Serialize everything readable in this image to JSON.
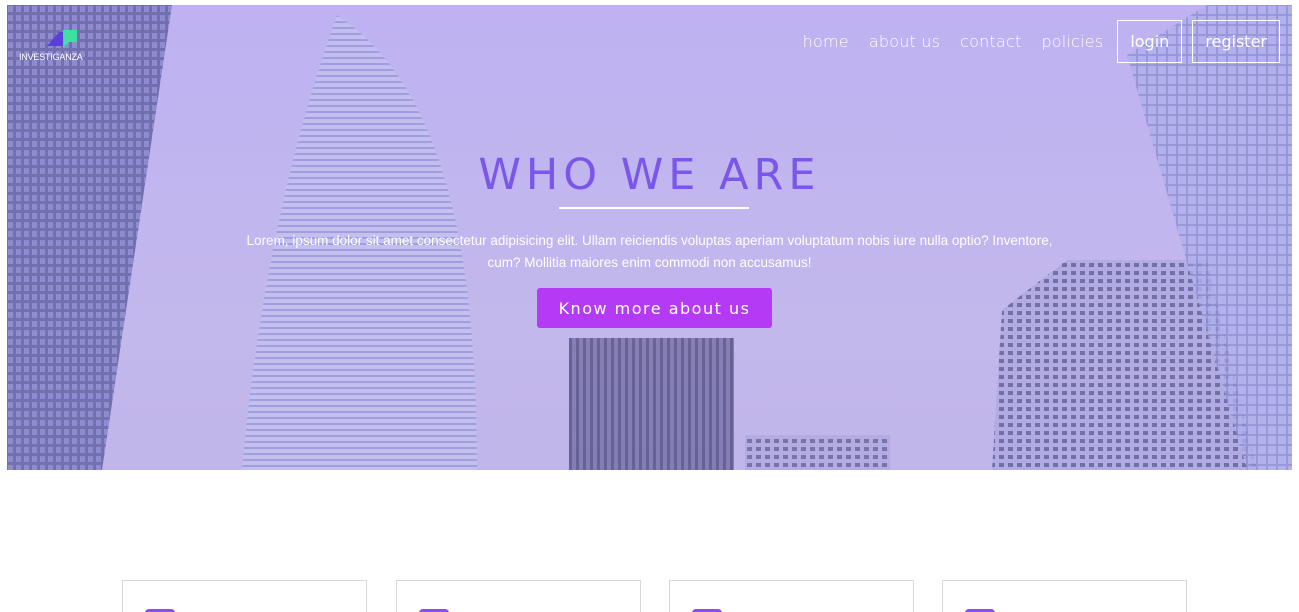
{
  "brand": {
    "name": "INVESTIGANZA",
    "colors": {
      "primary": "#7a56ea",
      "cta": "#b53af5",
      "logo_blue": "#5b3fd8",
      "logo_green": "#3fe0a0"
    }
  },
  "nav": {
    "links": [
      "home",
      "about us",
      "contact",
      "policies"
    ],
    "login_label": "login",
    "register_label": "register"
  },
  "hero": {
    "title": "WHO WE ARE",
    "text": "Lorem, ipsum dolor sit amet consectetur adipisicing elit. Ullam reiciendis voluptas aperiam voluptatum nobis iure nulla optio? Inventore, cum? Mollitia maiores enim commodi non accusamus!",
    "cta_label": "Know more about us"
  },
  "cards": [
    {
      "icon": "feature-icon"
    },
    {
      "icon": "feature-icon"
    },
    {
      "icon": "feature-icon"
    },
    {
      "icon": "feature-icon"
    }
  ]
}
